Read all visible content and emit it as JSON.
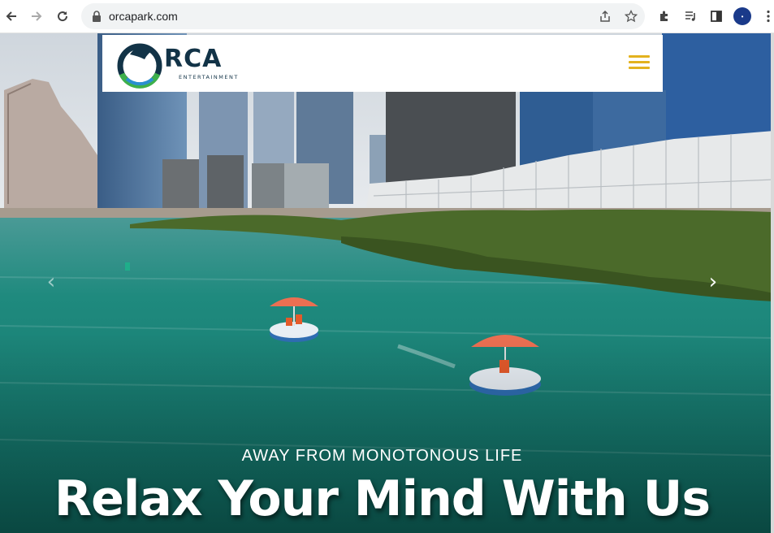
{
  "browser": {
    "url": "orcapark.com",
    "profile_initial": "•"
  },
  "site": {
    "logo_text": "RCA",
    "logo_subtext": "ENTERTAINMENT",
    "menu_icon": "hamburger-icon"
  },
  "hero": {
    "subtitle": "AWAY FROM MONOTONOUS LIFE",
    "headline": "Relax Your Mind With Us",
    "prev_arrow": "‹",
    "next_arrow": "›"
  },
  "colors": {
    "accent": "#e3b21e",
    "logo_navy": "#123347",
    "water": "#1f8a7e"
  }
}
